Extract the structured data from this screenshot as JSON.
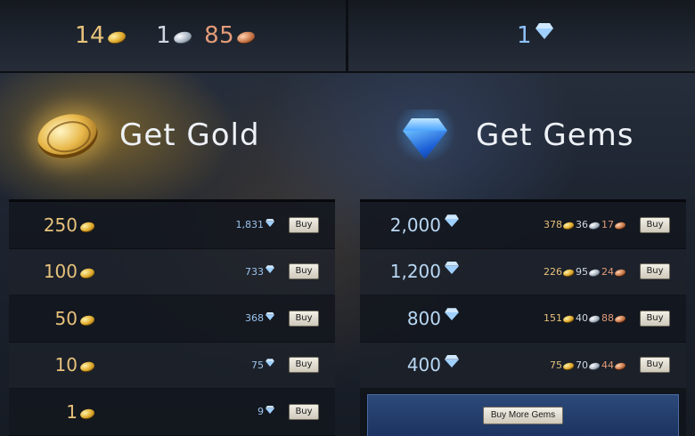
{
  "wallet": {
    "gold": "14",
    "silver": "1",
    "copper": "85",
    "gems": "1"
  },
  "gold_section": {
    "title": "Get Gold",
    "rows": [
      {
        "amount": "250",
        "gem_cost": "1,831",
        "buy_label": "Buy"
      },
      {
        "amount": "100",
        "gem_cost": "733",
        "buy_label": "Buy"
      },
      {
        "amount": "50",
        "gem_cost": "368",
        "buy_label": "Buy"
      },
      {
        "amount": "10",
        "gem_cost": "75",
        "buy_label": "Buy"
      },
      {
        "amount": "1",
        "gem_cost": "9",
        "buy_label": "Buy"
      }
    ]
  },
  "gems_section": {
    "title": "Get Gems",
    "rows": [
      {
        "amount": "2,000",
        "gold": "378",
        "silver": "36",
        "copper": "17",
        "buy_label": "Buy"
      },
      {
        "amount": "1,200",
        "gold": "226",
        "silver": "95",
        "copper": "24",
        "buy_label": "Buy"
      },
      {
        "amount": "800",
        "gold": "151",
        "silver": "40",
        "copper": "88",
        "buy_label": "Buy"
      },
      {
        "amount": "400",
        "gold": "75",
        "silver": "70",
        "copper": "44",
        "buy_label": "Buy"
      }
    ],
    "buy_more_label": "Buy More Gems"
  },
  "colors": {
    "gold_text": "#e7c27b",
    "silver_text": "#cfd7e2",
    "copper_text": "#e39b78",
    "gem_text": "#8fc1ff",
    "button_bg": "#e6e2d6"
  },
  "icons": {
    "gold": "gold-coin-icon",
    "silver": "silver-coin-icon",
    "copper": "copper-coin-icon",
    "gem": "gem-icon"
  }
}
